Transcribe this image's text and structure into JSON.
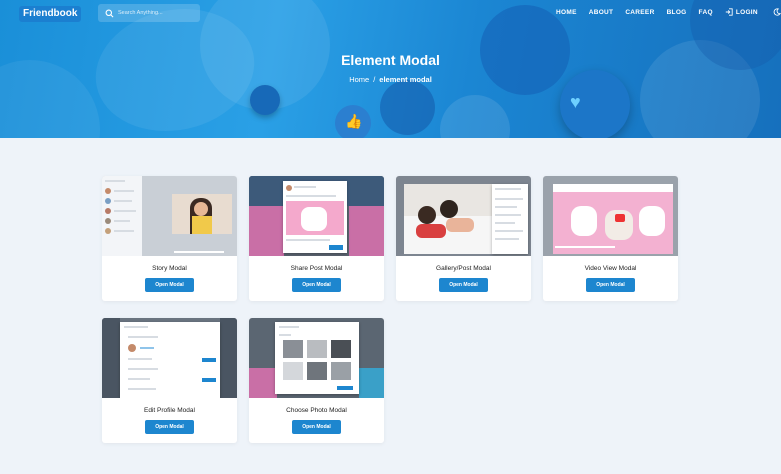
{
  "brand": {
    "logo_text": "Friendbook"
  },
  "search": {
    "placeholder": "Search Anything..."
  },
  "nav": {
    "items": [
      "HOME",
      "ABOUT",
      "CAREER",
      "BLOG",
      "FAQ"
    ],
    "login": "LOGIN"
  },
  "hero": {
    "title": "Element Modal",
    "breadcrumb_home": "Home",
    "breadcrumb_sep": "/",
    "breadcrumb_current": "element modal"
  },
  "cards": [
    {
      "title": "Story Modal",
      "button": "Open Modal"
    },
    {
      "title": "Share Post Modal",
      "button": "Open Modal"
    },
    {
      "title": "Gallery/Post Modal",
      "button": "Open Modal"
    },
    {
      "title": "Video View Modal",
      "button": "Open Modal"
    },
    {
      "title": "Edit Profile Modal",
      "button": "Open Modal"
    },
    {
      "title": "Choose Photo Modal",
      "button": "Open Modal"
    }
  ],
  "colors": {
    "hero": "#1b8ad6",
    "button": "#1d86cf",
    "page_bg": "#eef3f9"
  }
}
